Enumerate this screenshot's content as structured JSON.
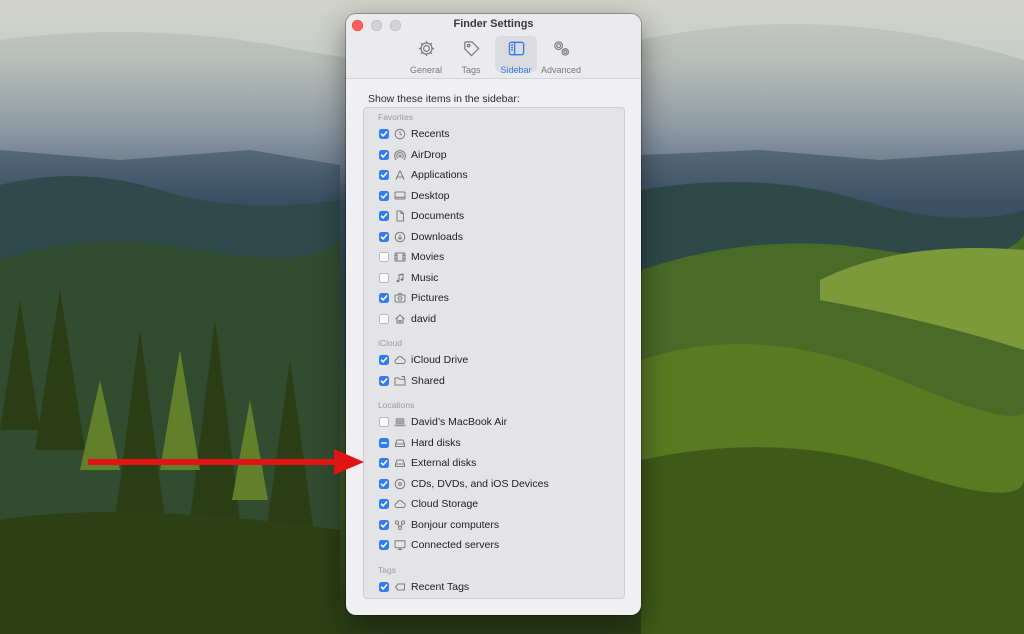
{
  "window": {
    "title": "Finder Settings"
  },
  "tabs": [
    {
      "label": "General",
      "icon": "gear-icon",
      "active": false
    },
    {
      "label": "Tags",
      "icon": "tag-icon",
      "active": false
    },
    {
      "label": "Sidebar",
      "icon": "sidebar-icon",
      "active": true
    },
    {
      "label": "Advanced",
      "icon": "gears-icon",
      "active": false
    }
  ],
  "sidebar": {
    "heading": "Show these items in the sidebar:",
    "sections": [
      {
        "label": "Favorites",
        "items": [
          {
            "label": "Recents",
            "icon": "clock-icon",
            "state": "checked"
          },
          {
            "label": "AirDrop",
            "icon": "airdrop-icon",
            "state": "checked"
          },
          {
            "label": "Applications",
            "icon": "applications-icon",
            "state": "checked"
          },
          {
            "label": "Desktop",
            "icon": "desktop-icon",
            "state": "checked"
          },
          {
            "label": "Documents",
            "icon": "document-icon",
            "state": "checked"
          },
          {
            "label": "Downloads",
            "icon": "download-icon",
            "state": "checked"
          },
          {
            "label": "Movies",
            "icon": "film-icon",
            "state": "unchecked"
          },
          {
            "label": "Music",
            "icon": "music-note-icon",
            "state": "unchecked"
          },
          {
            "label": "Pictures",
            "icon": "camera-icon",
            "state": "checked"
          },
          {
            "label": "david",
            "icon": "home-icon",
            "state": "unchecked"
          }
        ]
      },
      {
        "label": "iCloud",
        "items": [
          {
            "label": "iCloud Drive",
            "icon": "cloud-icon",
            "state": "checked"
          },
          {
            "label": "Shared",
            "icon": "shared-folder-icon",
            "state": "checked"
          }
        ]
      },
      {
        "label": "Locations",
        "items": [
          {
            "label": "David’s MacBook Air",
            "icon": "laptop-icon",
            "state": "unchecked"
          },
          {
            "label": "Hard disks",
            "icon": "hard-disk-icon",
            "state": "mixed"
          },
          {
            "label": "External disks",
            "icon": "external-disk-icon",
            "state": "checked"
          },
          {
            "label": "CDs, DVDs, and iOS Devices",
            "icon": "disc-icon",
            "state": "checked"
          },
          {
            "label": "Cloud Storage",
            "icon": "cloud-icon",
            "state": "checked"
          },
          {
            "label": "Bonjour computers",
            "icon": "network-icon",
            "state": "checked"
          },
          {
            "label": "Connected servers",
            "icon": "server-icon",
            "state": "checked"
          }
        ]
      },
      {
        "label": "Tags",
        "items": [
          {
            "label": "Recent Tags",
            "icon": "tag-outline-icon",
            "state": "checked"
          }
        ]
      }
    ]
  },
  "colors": {
    "accent": "#2f7cf6",
    "close_button": "#fe5f57",
    "arrow": "#e01414"
  }
}
